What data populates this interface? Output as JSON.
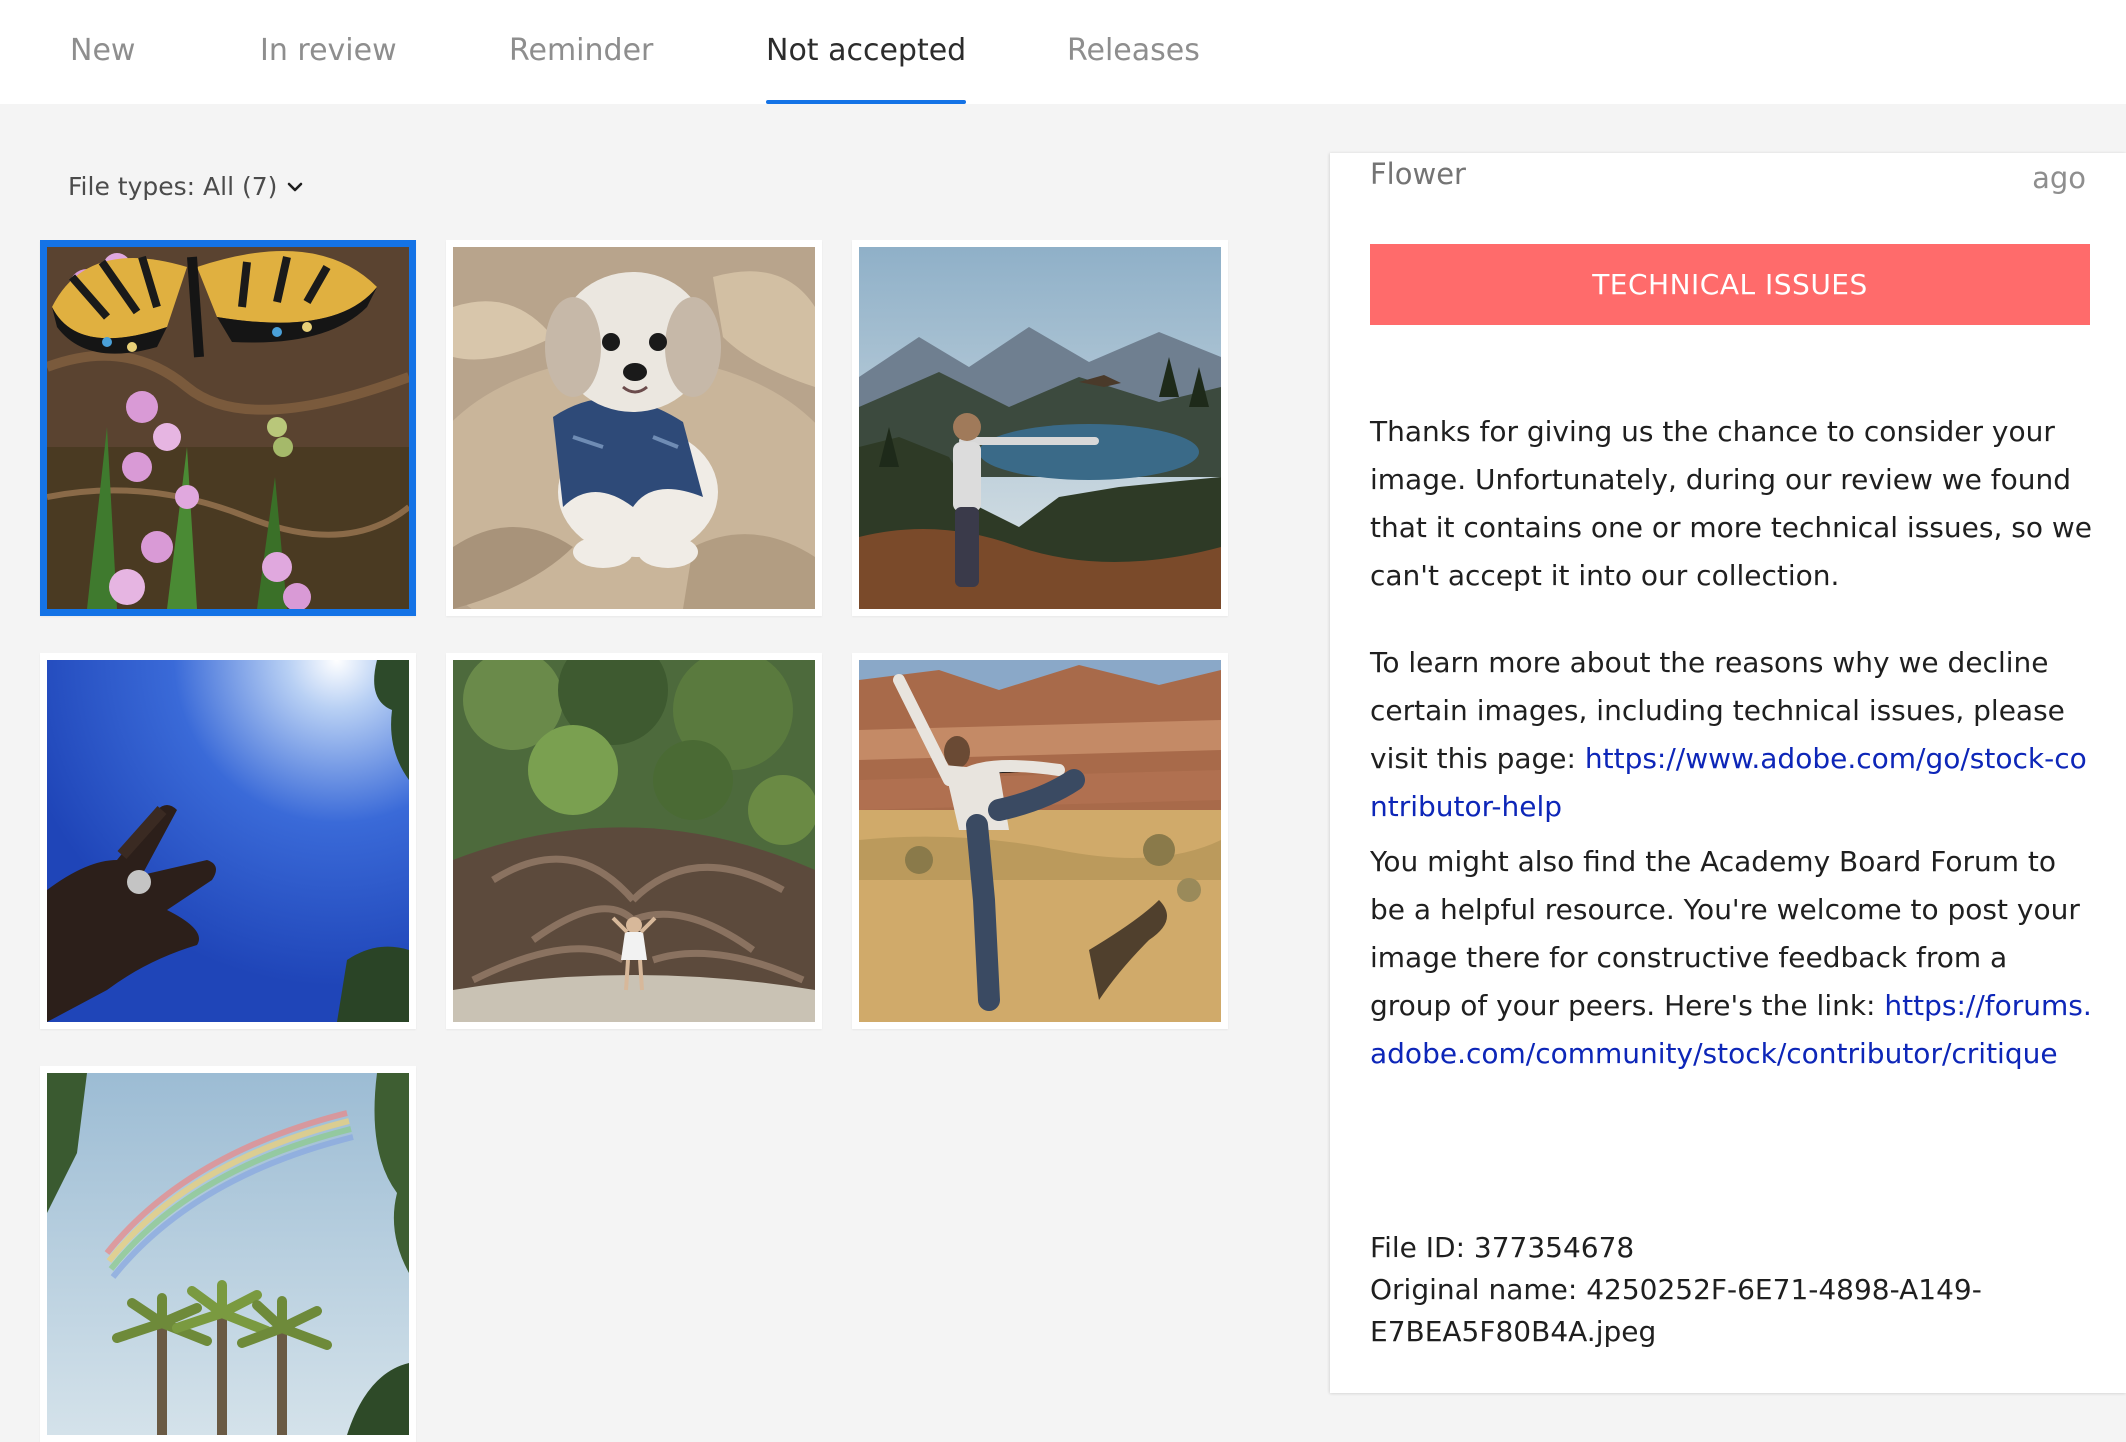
{
  "tabs": [
    {
      "label": "New",
      "active": false
    },
    {
      "label": "In review",
      "active": false
    },
    {
      "label": "Reminder",
      "active": false
    },
    {
      "label": "Not accepted",
      "active": true
    },
    {
      "label": "Releases",
      "active": false
    }
  ],
  "filter": {
    "label": "File types: All (7)"
  },
  "thumbnails": [
    {
      "subject": "butterfly on pink flowers",
      "selected": true
    },
    {
      "subject": "small dog in denim vest on fur blanket",
      "selected": false
    },
    {
      "subject": "person with arms out over mountain lake",
      "selected": false
    },
    {
      "subject": "hand against blue sky with sun",
      "selected": false
    },
    {
      "subject": "person standing under large tree roots",
      "selected": false
    },
    {
      "subject": "yoga pose in desert canyon",
      "selected": false
    },
    {
      "subject": "rainbow over palm trees",
      "selected": false
    }
  ],
  "panel": {
    "title": "Flower",
    "time_ago": "ago",
    "status": "TECHNICAL ISSUES",
    "paragraph1": "Thanks for giving us the chance to consider your image. Unfortunately, during our review we found that it contains one or more technical issues, so we can't accept it into our collection.",
    "paragraph2_text": "To learn more about the reasons why we decline certain images, including technical issues, please visit this page: ",
    "paragraph2_link": "https://www.adobe.com/go/stock-contributor-help",
    "paragraph3_text": "You might also find the Academy Board Forum to be a helpful resource. You're welcome to post your image there for constructive feedback from a group of your peers. Here's the link: ",
    "paragraph3_link": "https://forums.adobe.com/community/stock/contributor/critique",
    "file_id": "File ID: 377354678",
    "original_name": "Original name: 4250252F-6E71-4898-A149-E7BEA5F80B4A.jpeg"
  },
  "colors": {
    "accent": "#1473e6",
    "status_bg": "#ff6b6b",
    "link": "#0d26b8"
  }
}
